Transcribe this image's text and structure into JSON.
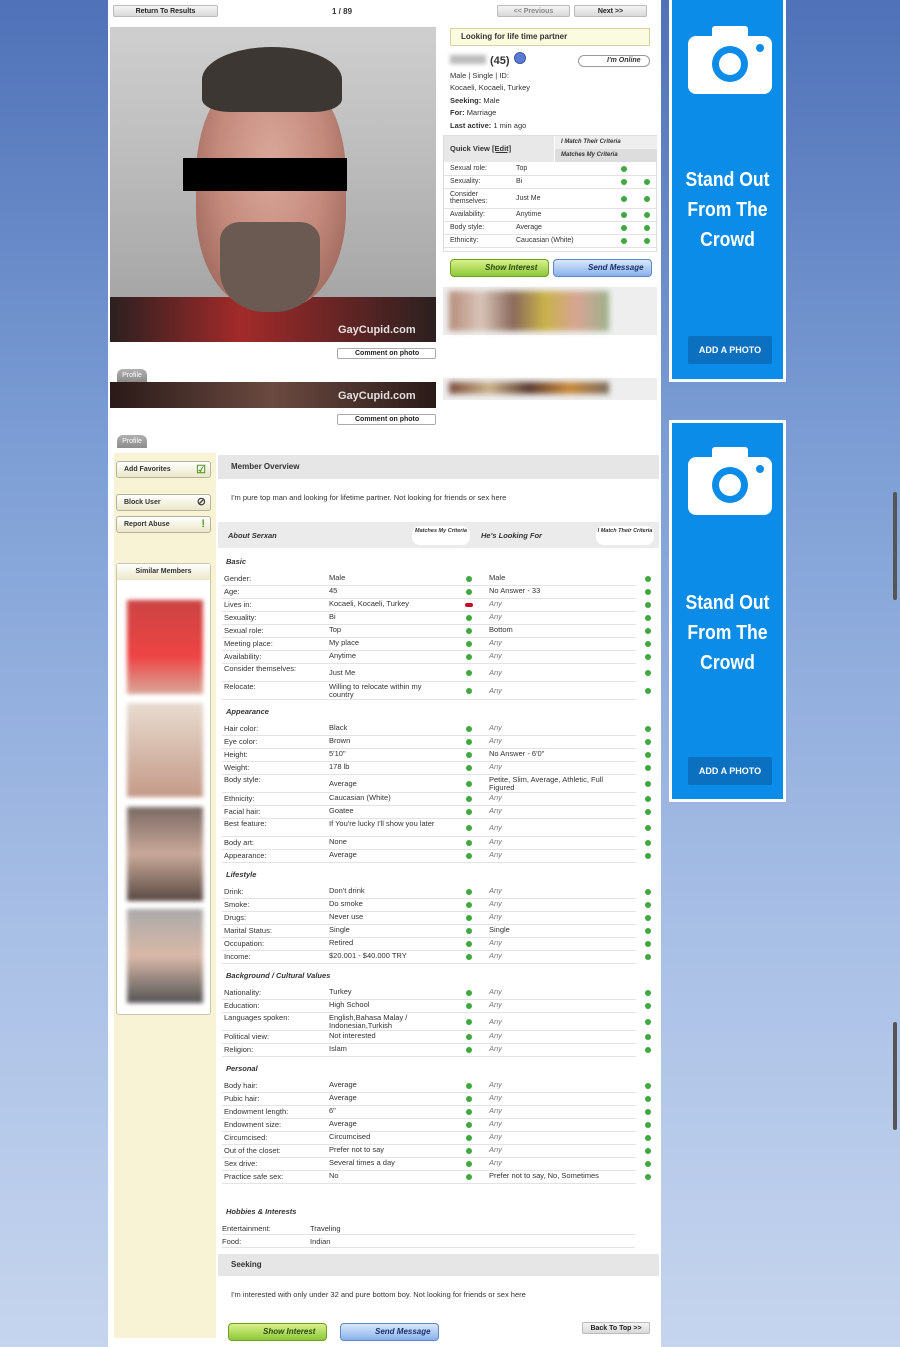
{
  "nav": {
    "return": "Return To Results",
    "counter": "1 / 89",
    "prev": "<< Previous",
    "next": "Next >>"
  },
  "photo": {
    "watermark": "GayCupid.com",
    "comment": "Comment on photo",
    "tab": "Profile"
  },
  "profile": {
    "headline": "Looking for life time partner",
    "name_age": "(45)",
    "online": "I'm Online",
    "line1": "Male | Single | ID:",
    "location": "Kocaeli, Kocaeli, Turkey",
    "seeking_label": "Seeking:",
    "seeking": "Male",
    "for_label": "For:",
    "for": "Marriage",
    "active_label": "Last active:",
    "active": "1 min ago"
  },
  "quickview": {
    "title": "Quick View",
    "edit": "[Edit]",
    "h1": "I Match Their Criteria",
    "h2": "Matches My Criteria",
    "rows": [
      {
        "label": "Sexual role:",
        "value": "Top"
      },
      {
        "label": "Sexuality:",
        "value": "Bi"
      },
      {
        "label": "Consider themselves:",
        "value": "Just Me"
      },
      {
        "label": "Availability:",
        "value": "Anytime"
      },
      {
        "label": "Body style:",
        "value": "Average"
      },
      {
        "label": "Ethnicity:",
        "value": "Caucasian (White)"
      }
    ]
  },
  "actions": {
    "interest": "Show Interest",
    "message": "Send Message"
  },
  "sidebar": {
    "fav": "Add Favorites",
    "block": "Block User",
    "report": "Report Abuse",
    "similar": "Similar Members"
  },
  "overview": {
    "title": "Member Overview",
    "text": "I'm pure top man and looking for lifetime partner. Not looking for friends or sex here",
    "about": "About Serxan",
    "matches": "Matches My Criteria",
    "looking": "He's Looking For",
    "imatch": "I Match Their Criteria"
  },
  "sections": [
    {
      "title": "Basic",
      "rows": [
        [
          "Gender:",
          "Male",
          "Male"
        ],
        [
          "Age:",
          "45",
          "No Answer - 33"
        ],
        [
          "Lives in:",
          "Kocaeli, Kocaeli, Turkey",
          "Any"
        ],
        [
          "Sexuality:",
          "Bi",
          "Any"
        ],
        [
          "Sexual role:",
          "Top",
          "Bottom"
        ],
        [
          "Meeting place:",
          "My place",
          "Any"
        ],
        [
          "Availability:",
          "Anytime",
          "Any"
        ],
        [
          "Consider themselves:",
          "Just Me",
          "Any"
        ],
        [
          "Relocate:",
          "Willing to relocate within my country",
          "Any"
        ]
      ]
    },
    {
      "title": "Appearance",
      "rows": [
        [
          "Hair color:",
          "Black",
          "Any"
        ],
        [
          "Eye color:",
          "Brown",
          "Any"
        ],
        [
          "Height:",
          "5'10\"",
          "No Answer - 6'0\""
        ],
        [
          "Weight:",
          "178 lb",
          "Any"
        ],
        [
          "Body style:",
          "Average",
          "Petite, Slim, Average, Athletic, Full Figured"
        ],
        [
          "Ethnicity:",
          "Caucasian (White)",
          "Any"
        ],
        [
          "Facial hair:",
          "Goatee",
          "Any"
        ],
        [
          "Best feature:",
          "If You're lucky I'll show you later",
          "Any"
        ],
        [
          "Body art:",
          "None",
          "Any"
        ],
        [
          "Appearance:",
          "Average",
          "Any"
        ]
      ]
    },
    {
      "title": "Lifestyle",
      "rows": [
        [
          "Drink:",
          "Don't drink",
          "Any"
        ],
        [
          "Smoke:",
          "Do smoke",
          "Any"
        ],
        [
          "Drugs:",
          "Never use",
          "Any"
        ],
        [
          "Marital Status:",
          "Single",
          "Single"
        ],
        [
          "Occupation:",
          "Retired",
          "Any"
        ],
        [
          "Income:",
          "$20.001 - $40.000 TRY",
          "Any"
        ]
      ]
    },
    {
      "title": "Background / Cultural Values",
      "rows": [
        [
          "Nationality:",
          "Turkey",
          "Any"
        ],
        [
          "Education:",
          "High School",
          "Any"
        ],
        [
          "Languages spoken:",
          "English,Bahasa Malay / Indonesian,Turkish",
          "Any"
        ],
        [
          "Political view:",
          "Not interested",
          "Any"
        ],
        [
          "Religion:",
          "Islam",
          "Any"
        ]
      ]
    },
    {
      "title": "Personal",
      "rows": [
        [
          "Body hair:",
          "Average",
          "Any"
        ],
        [
          "Pubic hair:",
          "Average",
          "Any"
        ],
        [
          "Endowment length:",
          "6\"",
          "Any"
        ],
        [
          "Endowment size:",
          "Average",
          "Any"
        ],
        [
          "Circumcised:",
          "Circumcised",
          "Any"
        ],
        [
          "Out of the closet:",
          "Prefer not to say",
          "Any"
        ],
        [
          "Sex drive:",
          "Several times a day",
          "Any"
        ],
        [
          "Practice safe sex:",
          "No",
          "Prefer not to say, No, Sometimes"
        ]
      ]
    }
  ],
  "hobbies": {
    "title": "Hobbies & Interests",
    "rows": [
      [
        "Entertainment:",
        "Traveling"
      ],
      [
        "Food:",
        "Indian"
      ]
    ]
  },
  "seeking": {
    "title": "Seeking",
    "text": "I'm interested with only under 32 and pure bottom boy. Not looking for friends or sex here"
  },
  "backtop": "Back To Top >>",
  "ad": {
    "line1": "Stand Out",
    "line2": "From The",
    "line3": "Crowd",
    "button": "ADD A PHOTO"
  }
}
